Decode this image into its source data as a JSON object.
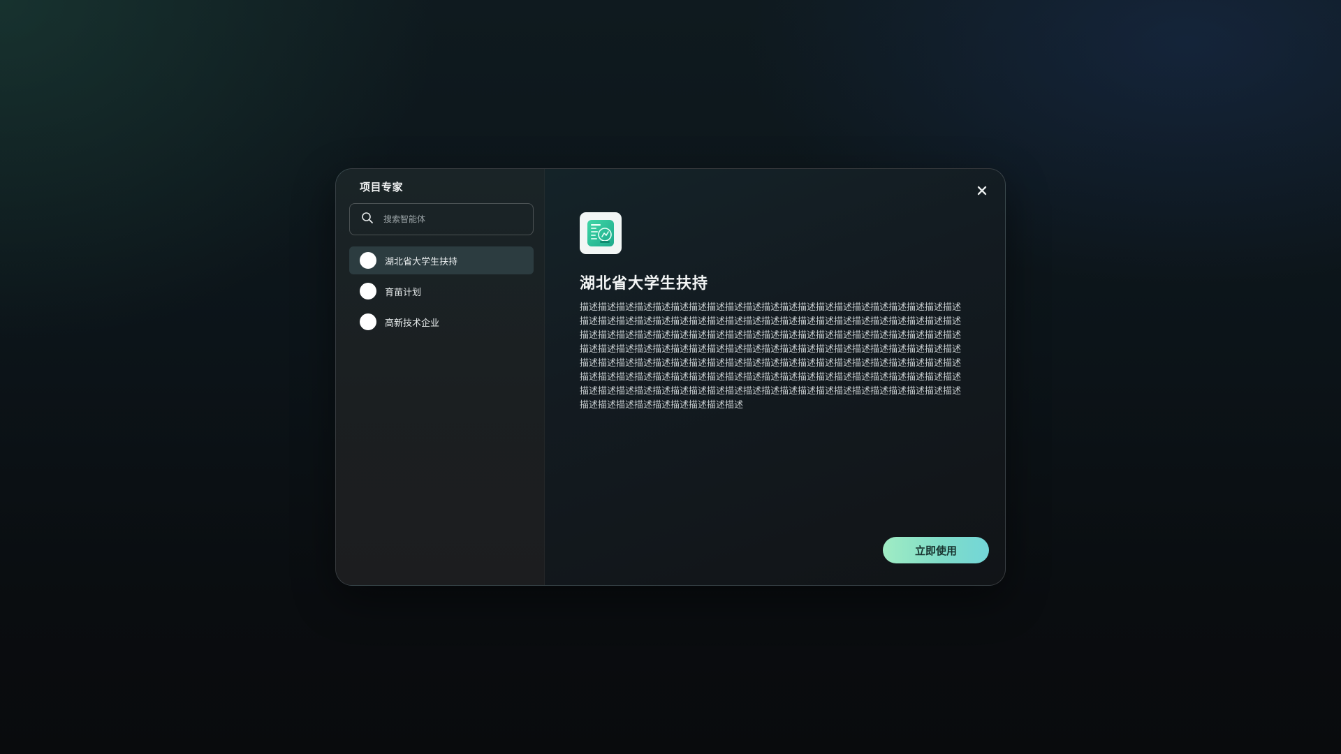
{
  "modal": {
    "title": "项目专家",
    "close_icon": "close-icon"
  },
  "search": {
    "placeholder": "搜索智能体",
    "icon": "search-icon"
  },
  "agents": [
    {
      "label": "湖北省大学生扶持",
      "active": true
    },
    {
      "label": "育苗计划",
      "active": false
    },
    {
      "label": "高新技术企业",
      "active": false
    }
  ],
  "detail": {
    "icon": "spreadsheet-app-icon",
    "title": "湖北省大学生扶持",
    "description": "描述描述描述描述描述描述描述描述描述描述描述描述描述描述描述描述描述描述描述描述描述描述描述描述描述描述描述描述描述描述描述描述描述描述描述描述描述描述描述描述描述描述描述描述描述描述描述描述描述描述描述描述描述描述描述描述描述描述描述描述描述描述描述描述描述描述描述描述描述描述描述描述描述描述描述描述描述描述描述描述描述描述描述描述描述描述描述描述描述描述描述描述描述描述描述描述描述描述描述描述描述描述描述描述描述描述描述描述描述描述描述描述描述描述描述描述描述描述描述描述描述描述描述描述描述描述描述描述描述描述描述描述描述描述描述描述描述描述描述描述描述描述描述描述描述描述描述描述描述描述描述描述描述描述描述描述",
    "use_button_label": "立即使用"
  },
  "colors": {
    "accent_start": "#a0ecc4",
    "accent_end": "#73d6d8",
    "active_item_bg": "#2c3c40"
  }
}
